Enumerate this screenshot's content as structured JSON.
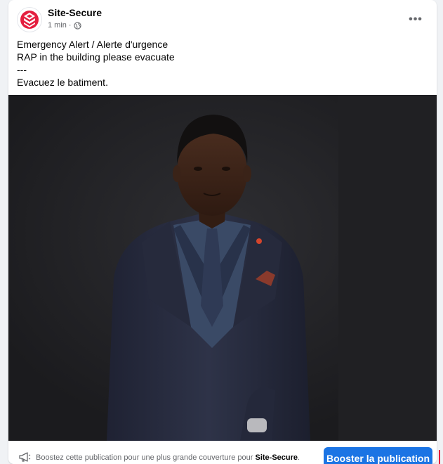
{
  "post": {
    "page_name": "Site-Secure",
    "timestamp": "1 min",
    "separator": "·",
    "audience_icon": "globe-icon",
    "more_label": "•••",
    "lines": [
      "Emergency Alert / Alerte d'urgence",
      "RAP in the building please evacuate",
      "---",
      "Evacuez le batiment."
    ]
  },
  "media": {
    "type": "photo",
    "subject": "portrait"
  },
  "boost": {
    "icon": "megaphone-icon",
    "text_prefix": "Boostez cette publication pour une plus grande couverture pour",
    "page_name": "Site-Secure",
    "text_suffix": ".",
    "button_label": "Booster la publication"
  },
  "colors": {
    "accent": "#1b74e4",
    "logo_red": "#e41e3f",
    "photo_bg": "#222225",
    "text_secondary": "#65676b"
  }
}
